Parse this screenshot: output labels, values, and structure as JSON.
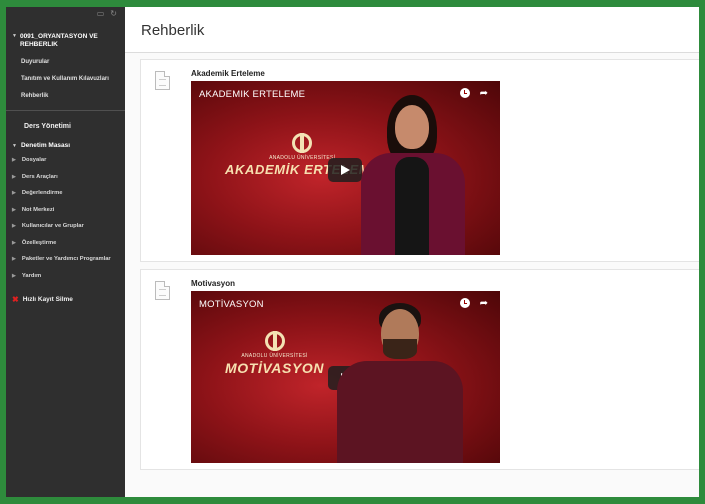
{
  "sidebar": {
    "course_title": "0091_ORYANTASYON VE REHBERLIK",
    "course_menu": [
      "Duyurular",
      "Tanıtım ve Kullanım Kılavuzları",
      "Rehberlik"
    ],
    "ders_yonetimi": "Ders Yönetimi",
    "panel_heading": "Denetim Masası",
    "panel_items": [
      "Dosyalar",
      "Ders Araçları",
      "Değerlendirme",
      "Not Merkezi",
      "Kullanıcılar ve Gruplar",
      "Özelleştirme",
      "Paketler ve Yardımcı Programlar",
      "Yardım"
    ],
    "quick_link": "Hızlı Kayıt Silme"
  },
  "page": {
    "title": "Rehberlik"
  },
  "items": [
    {
      "title": "Akademik Erteleme",
      "video_title": "AKADEMIK ERTELEME",
      "logo_uni": "ANADOLU ÜNİVERSİTESİ",
      "logo_word": "AKADEMİK ERTELEME"
    },
    {
      "title": "Motivasyon",
      "video_title": "MOTİVASYON",
      "logo_uni": "ANADOLU ÜNİVERSİTESİ",
      "logo_word": "MOTİVASYON"
    }
  ],
  "colors": {
    "frame_border": "#2e8b3c",
    "sidebar_bg": "#2f2f2f",
    "video_red": "#8e1318",
    "quick_link_icon": "#e02020"
  },
  "icons": {
    "document": "document-icon",
    "clock": "watch-later-icon",
    "share": "share-icon",
    "play": "play-icon"
  }
}
